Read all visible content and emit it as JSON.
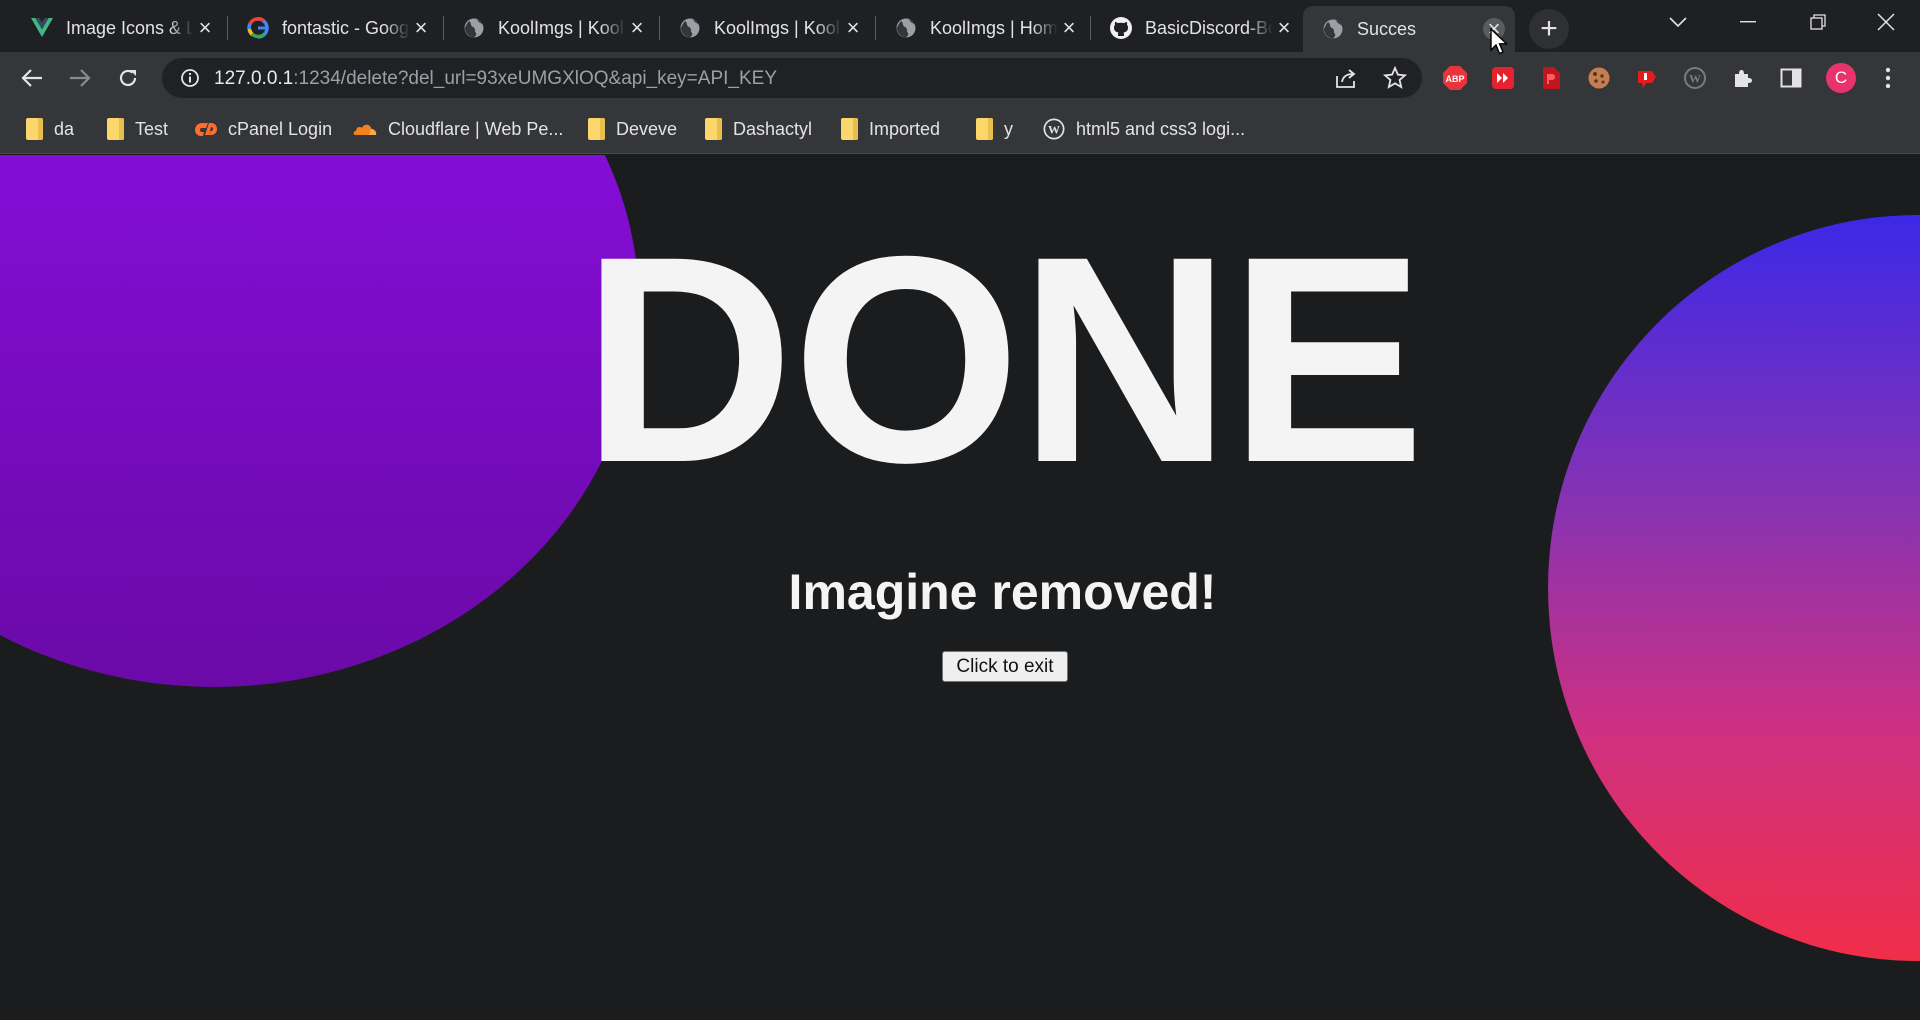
{
  "browser": {
    "tabs": [
      {
        "title": "Image Icons & Logos",
        "icon": "vue-logo-icon"
      },
      {
        "title": "fontastic - Google Search",
        "icon": "google-logo-icon"
      },
      {
        "title": "KoolImgs | KoolImgs",
        "icon": "globe-icon"
      },
      {
        "title": "KoolImgs | KoolImgs",
        "icon": "globe-icon"
      },
      {
        "title": "KoolImgs | Home",
        "icon": "globe-icon"
      },
      {
        "title": "BasicDiscord-Bot",
        "icon": "github-logo-icon"
      },
      {
        "title": "Succes",
        "icon": "globe-icon",
        "active": true
      }
    ],
    "url": {
      "host": "127.0.0.1",
      "rest": ":1234/delete?del_url=93xeUMGXlOQ&api_key=API_KEY"
    },
    "profile_initial": "C",
    "extensions": [
      "adblock-icon",
      "redirect-icon",
      "pdf-icon",
      "cookie-icon",
      "youtube-dislike-icon",
      "wordpress-icon"
    ]
  },
  "bookmarks": [
    {
      "label": "da",
      "icon": "folder-icon"
    },
    {
      "label": "Test",
      "icon": "folder-icon"
    },
    {
      "label": "cPanel Login",
      "icon": "cpanel-icon"
    },
    {
      "label": "Cloudflare | Web Pe...",
      "icon": "cloudflare-icon"
    },
    {
      "label": "Deveve",
      "icon": "folder-icon"
    },
    {
      "label": "Dashactyl",
      "icon": "folder-icon"
    },
    {
      "label": "Imported",
      "icon": "folder-icon"
    },
    {
      "label": "y",
      "icon": "folder-icon"
    },
    {
      "label": "html5 and css3 logi...",
      "icon": "wordpress-icon"
    }
  ],
  "page": {
    "heading": "DONE",
    "subtitle": "Imagine removed!",
    "exit_button": "Click to exit"
  },
  "colors": {
    "page_background": "#1b1c1e",
    "left_circle": "#8e10ec",
    "right_circle_top": "#3c28e8",
    "right_circle_bottom": "#f02e48"
  }
}
